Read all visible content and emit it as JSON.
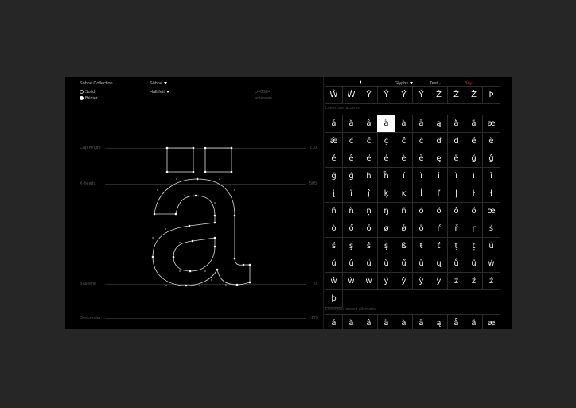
{
  "left_panel": {
    "collection": "Söhne Collection",
    "font": "Söhne",
    "weight": "Halbfett",
    "modes": [
      {
        "label": "Solid",
        "selected": false
      },
      {
        "label": "Bézier",
        "selected": true
      }
    ],
    "unicode_code": "U+00E4",
    "unicode_name": "adieresis",
    "metrics": [
      {
        "name": "Cap height",
        "value": "710"
      },
      {
        "name": "X-height",
        "value": "505"
      },
      {
        "name": "Baseline",
        "value": "0"
      },
      {
        "name": "Descender",
        "value": "-175"
      }
    ]
  },
  "top_nav": {
    "glyphs_label": "Glyphs",
    "test_label": "Test",
    "buy_label": "Buy",
    "buy_color": "#e1251b"
  },
  "top_row": [
    "Ŵ",
    "Ẃ",
    "Ý",
    "Ŷ",
    "Ÿ",
    "Ỳ",
    "Ź",
    "Ž",
    "Ż",
    "Þ"
  ],
  "sections": [
    {
      "label": "Lowercase accents",
      "glyphs": [
        "á",
        "ă",
        "â",
        "ä",
        "à",
        "ā",
        "ą",
        "å",
        "ã",
        "æ",
        "ǽ",
        "ć",
        "č",
        "ç",
        "ĉ",
        "ċ",
        "ď",
        "đ",
        "é",
        "ĕ",
        "ě",
        "ê",
        "ë",
        "ė",
        "è",
        "ē",
        "ę",
        "ẽ",
        "ğ",
        "ĝ",
        "ģ",
        "ġ",
        "ħ",
        "ĥ",
        "í",
        "ĭ",
        "î",
        "ï",
        "ì",
        "ī",
        "į",
        "ĩ",
        "ĵ",
        "ķ",
        "ĸ",
        "ĺ",
        "ľ",
        "ļ",
        "ŀ",
        "ł",
        "ń",
        "ň",
        "ņ",
        "ŋ",
        "ñ",
        "ó",
        "ŏ",
        "ô",
        "ö",
        "œ",
        "ò",
        "ő",
        "ō",
        "ø",
        "ǿ",
        "õ",
        "ŕ",
        "ř",
        "ŗ",
        "ś",
        "š",
        "ş",
        "ŝ",
        "ș",
        "ß",
        "ŧ",
        "ť",
        "ţ",
        "ț",
        "ú",
        "ŭ",
        "û",
        "ü",
        "ù",
        "ű",
        "ū",
        "ų",
        "ů",
        "ũ",
        "ẃ",
        "ŵ",
        "ẅ",
        "ẁ",
        "ý",
        "ŷ",
        "ÿ",
        "ỳ",
        "ź",
        "ž",
        "ż",
        "þ"
      ],
      "selected_index": 3
    },
    {
      "label": "Lowercase accent alternates",
      "glyphs": [
        "á",
        "ă",
        "â",
        "ä",
        "à",
        "ā",
        "ą",
        "å",
        "ã",
        "æ"
      ]
    }
  ]
}
